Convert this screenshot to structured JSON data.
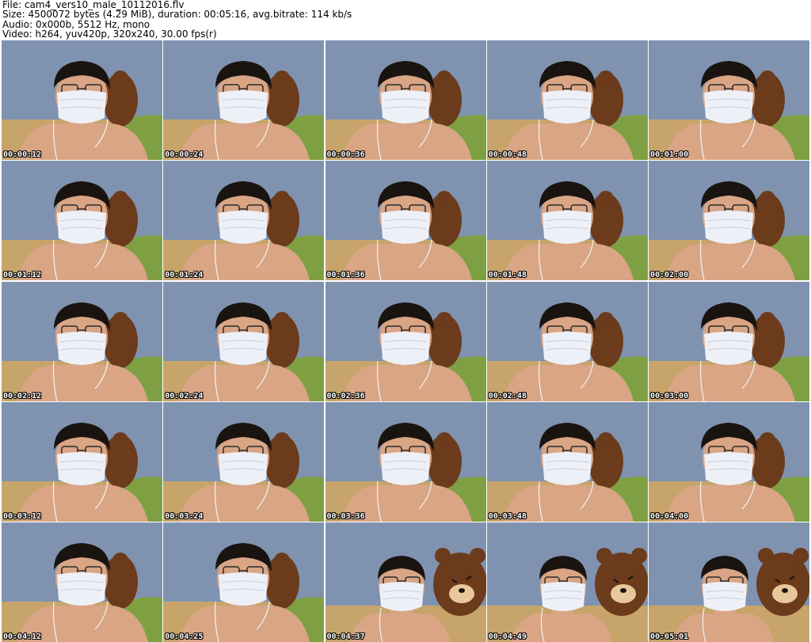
{
  "header": {
    "file_line": "File: cam4_vers10_male_10112016.flv",
    "size_line": "Size: 4500072 bytes (4.29 MiB), duration: 00:05:16, avg.bitrate: 114 kb/s",
    "audio_line": "Audio: 0x000b, 5512 Hz, mono",
    "video_line": "Video: h264, yuv420p, 320x240, 30.00 fps(r)"
  },
  "colors": {
    "wall": "#7f93b0",
    "floor": "#c6a46a",
    "pillow": "#7fa042",
    "bear": "#6b3b1c",
    "skin": "#d9a585",
    "hair": "#1a1410",
    "mask": "#eef0f8"
  },
  "frames": [
    {
      "timestamp": "00:00:12",
      "scene": "close"
    },
    {
      "timestamp": "00:00:24",
      "scene": "close"
    },
    {
      "timestamp": "00:00:36",
      "scene": "close"
    },
    {
      "timestamp": "00:00:48",
      "scene": "close"
    },
    {
      "timestamp": "00:01:00",
      "scene": "close"
    },
    {
      "timestamp": "00:01:12",
      "scene": "close"
    },
    {
      "timestamp": "00:01:24",
      "scene": "close"
    },
    {
      "timestamp": "00:01:36",
      "scene": "close"
    },
    {
      "timestamp": "00:01:48",
      "scene": "close"
    },
    {
      "timestamp": "00:02:00",
      "scene": "close"
    },
    {
      "timestamp": "00:02:12",
      "scene": "close"
    },
    {
      "timestamp": "00:02:24",
      "scene": "close"
    },
    {
      "timestamp": "00:02:36",
      "scene": "close"
    },
    {
      "timestamp": "00:02:48",
      "scene": "close"
    },
    {
      "timestamp": "00:03:00",
      "scene": "close"
    },
    {
      "timestamp": "00:03:12",
      "scene": "close"
    },
    {
      "timestamp": "00:03:24",
      "scene": "close"
    },
    {
      "timestamp": "00:03:36",
      "scene": "close"
    },
    {
      "timestamp": "00:03:48",
      "scene": "close"
    },
    {
      "timestamp": "00:04:00",
      "scene": "close"
    },
    {
      "timestamp": "00:04:12",
      "scene": "close"
    },
    {
      "timestamp": "00:04:25",
      "scene": "close"
    },
    {
      "timestamp": "00:04:37",
      "scene": "bear"
    },
    {
      "timestamp": "00:04:49",
      "scene": "bear"
    },
    {
      "timestamp": "00:05:01",
      "scene": "bear"
    }
  ]
}
